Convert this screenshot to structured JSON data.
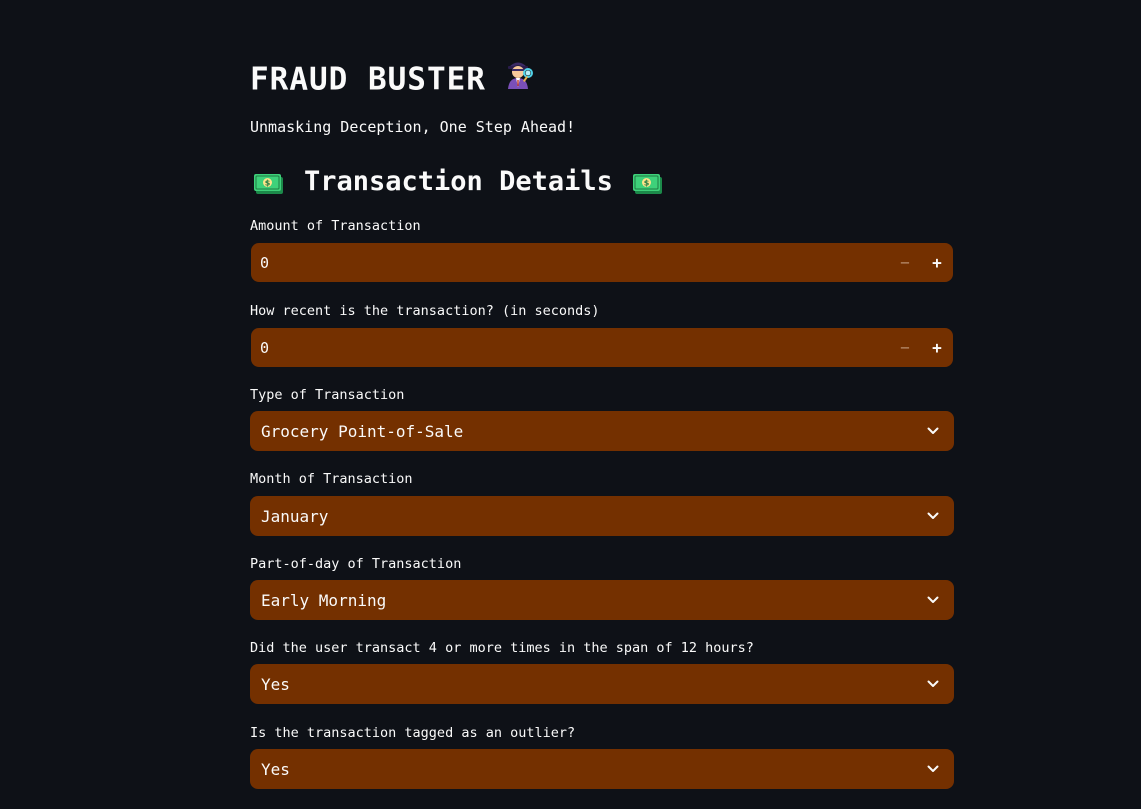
{
  "header": {
    "title": "FRAUD BUSTER",
    "title_icon": "detective-icon",
    "subtitle": "Unmasking Deception, One Step Ahead!"
  },
  "section": {
    "title": "Transaction Details",
    "icon": "money-icon"
  },
  "fields": {
    "amount": {
      "label": "Amount of Transaction",
      "value": "0",
      "decrement": "−",
      "increment": "+"
    },
    "recency": {
      "label": "How recent is the transaction? (in seconds)",
      "value": "0",
      "decrement": "−",
      "increment": "+"
    },
    "type": {
      "label": "Type of Transaction",
      "value": "Grocery Point-of-Sale"
    },
    "month": {
      "label": "Month of Transaction",
      "value": "January"
    },
    "part_of_day": {
      "label": "Part-of-day of Transaction",
      "value": "Early Morning"
    },
    "frequency": {
      "label": "Did the user transact 4 or more times in the span of 12 hours?",
      "value": "Yes"
    },
    "outlier": {
      "label": "Is the transaction tagged as an outlier?",
      "value": "Yes"
    }
  },
  "colors": {
    "background": "#0e1117",
    "input_background": "#743000",
    "text": "#fafafa"
  }
}
